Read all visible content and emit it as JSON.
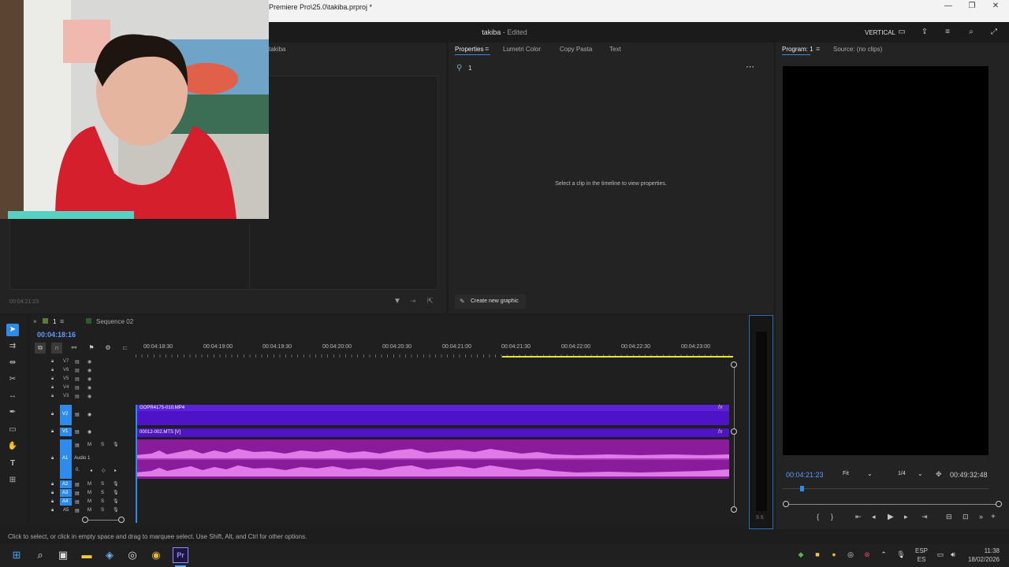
{
  "window": {
    "title": "Premiere Pro\\25.0\\takiba.prproj *",
    "minimize": "—",
    "maximize": "❐",
    "close": "✕"
  },
  "header": {
    "project_name": "takiba",
    "project_state": "- Edited",
    "workspace": "VERTICAL"
  },
  "left_panel": {
    "tab": "takiba",
    "timecode": "00:04:21:23"
  },
  "properties_panel": {
    "tabs": [
      "Properties",
      "Lumetri Color",
      "Copy Pasta",
      "Text"
    ],
    "selection_count": "1",
    "empty_message": "Select a clip in the timeline to view properties.",
    "create_graphic": "Create new graphic"
  },
  "program_panel": {
    "tab_program": "Program: 1",
    "tab_source": "Source: (no clips)",
    "current_time": "00:04:21:23",
    "fit": "Fit",
    "resolution": "1/4",
    "duration": "00:49:32:48"
  },
  "timeline": {
    "tabs": [
      "1",
      "Sequence 02"
    ],
    "timecode": "00:04:18:16",
    "ruler": [
      "00:04:18:30",
      "00:04:19:00",
      "00:04:19:30",
      "00:04:20:00",
      "00:04:20:30",
      "00:04:21:00",
      "00:04:21:30",
      "00:04:22:00",
      "00:04:22:30",
      "00:04:23:00"
    ],
    "video_tracks": [
      "V7",
      "V6",
      "V5",
      "V4",
      "V3",
      "V2",
      "V1"
    ],
    "audio_tracks": [
      "A1",
      "A2",
      "A3",
      "A4",
      "A5"
    ],
    "audio_track_name": "Audio 1",
    "track_buttons": {
      "mute": "M",
      "solo": "S",
      "zero": "0."
    },
    "clip_v2": "GOPR4175-010.MP4",
    "clip_v1": "00012-002.MTS [V]",
    "fx": "fx",
    "meter_label": "S S"
  },
  "status_bar": {
    "text": "Click to select, or click in empty space and drag to marquee select. Use Shift, Alt, and Ctrl for other options."
  },
  "taskbar": {
    "lang_top": "ESP",
    "lang_bottom": "ES",
    "time": "11:38",
    "date": "18/02/2026"
  },
  "colors": {
    "accent_blue": "#2d8ceb",
    "clip_purple": "#4e13c6",
    "audio_magenta": "#8a1c9c",
    "waveform": "#e07ae8",
    "playhead_yellow": "#e6e62e"
  }
}
